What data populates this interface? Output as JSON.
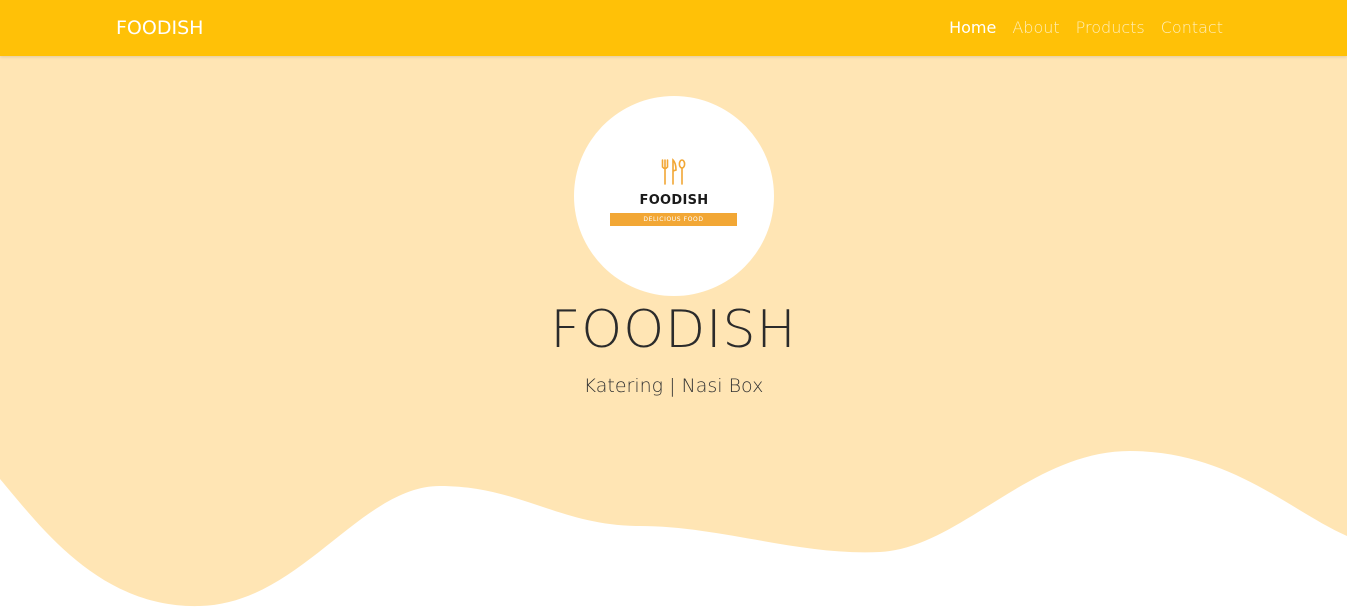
{
  "navbar": {
    "brand": "FOODISH",
    "links": [
      {
        "label": "Home",
        "active": true
      },
      {
        "label": "About",
        "active": false
      },
      {
        "label": "Products",
        "active": false
      },
      {
        "label": "Contact",
        "active": false
      }
    ]
  },
  "hero": {
    "logo": {
      "name": "FOODISH",
      "tagline": "DELICIOUS FOOD"
    },
    "title": "FOODISH",
    "subtitle": "Katering | Nasi Box"
  },
  "colors": {
    "navbar_bg": "#ffc107",
    "hero_bg": "#ffe5b4",
    "logo_accent": "#f2a735",
    "wave_fill": "#ffffff"
  },
  "icons": [
    "utensils-icon"
  ]
}
